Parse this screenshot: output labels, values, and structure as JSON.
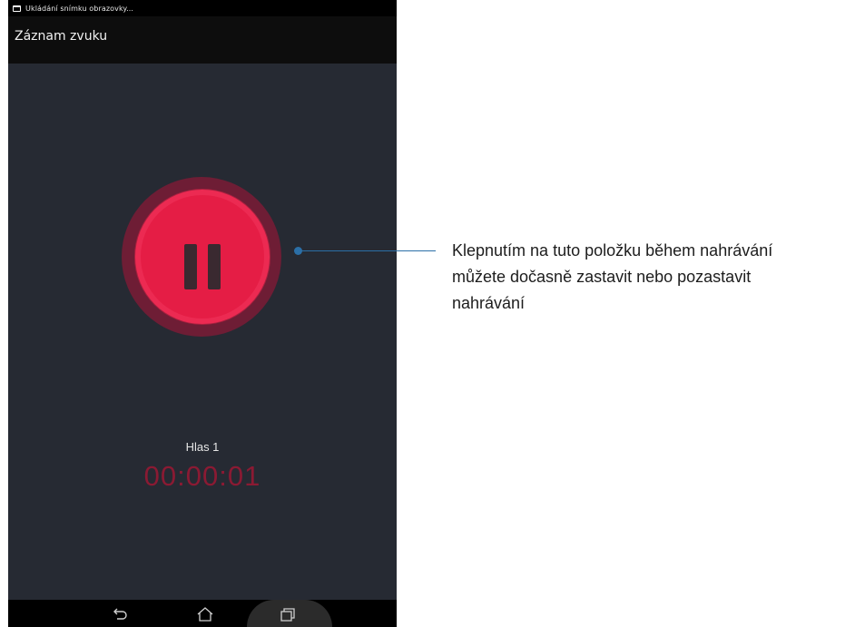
{
  "status_bar": {
    "notification": "Ukládání snímku obrazovky..."
  },
  "app": {
    "title": "Záznam zvuku"
  },
  "recording": {
    "name": "Hlas 1",
    "elapsed": "00:00:01"
  },
  "colors": {
    "record_red": "#e51d45",
    "timer_red": "#8a1a33",
    "callout_blue": "#2b6fa7"
  },
  "nav": {
    "back_icon": "back-icon",
    "home_icon": "home-icon",
    "recent_icon": "recent-apps-icon"
  },
  "callout": {
    "line1": "Klepnutím na tuto položku během nahrávání",
    "line2": "můžete dočasně zastavit nebo pozastavit",
    "line3": "nahrávání"
  }
}
